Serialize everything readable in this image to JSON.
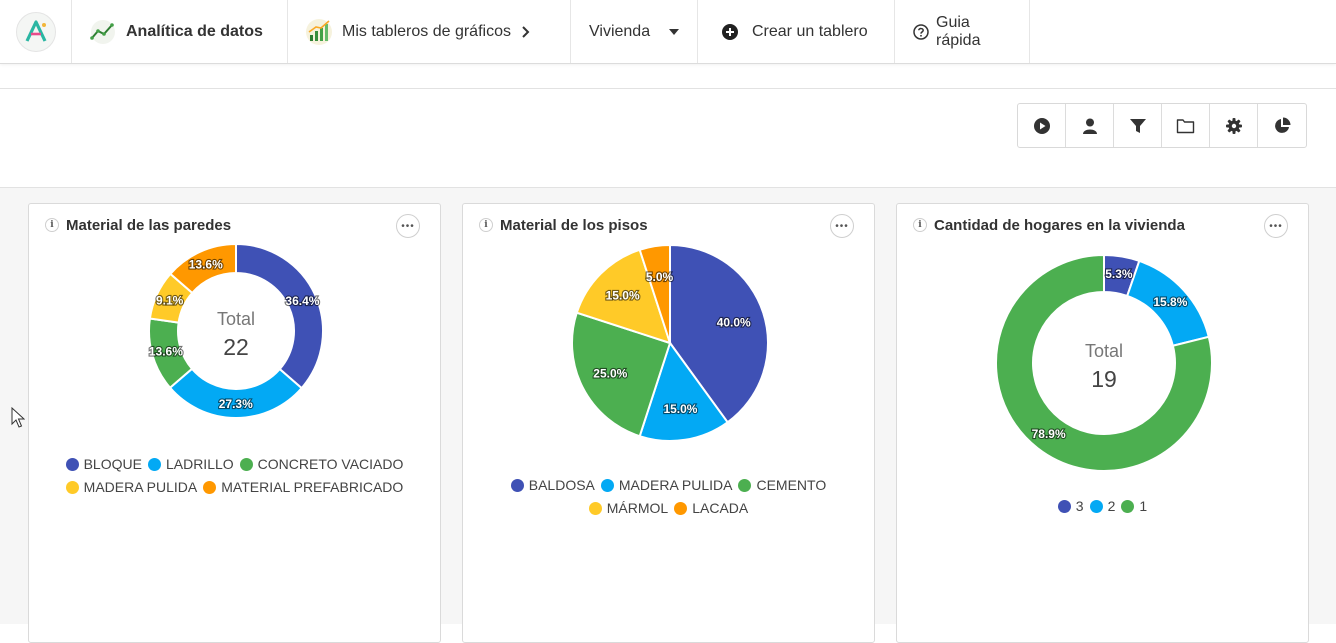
{
  "nav": {
    "analytics_label": "Analítica de datos",
    "boards_label": "Mis tableros de gráficos",
    "dataset_label": "Vivienda",
    "create_label": "Crear un tablero",
    "guide_label": "Guia rápida"
  },
  "toolbar": {
    "buttons": [
      "play-icon",
      "user-icon",
      "filter-icon",
      "folder-icon",
      "gear-icon",
      "pie-chart-icon"
    ]
  },
  "colors": {
    "blue": "#3F51B5",
    "lightblue": "#03A9F4",
    "green": "#4CAF50",
    "yellow": "#FFCA28",
    "orange": "#FF9800"
  },
  "cards": [
    {
      "title": "Material de las paredes",
      "total_label": "Total",
      "total_value": "22"
    },
    {
      "title": "Material de los pisos"
    },
    {
      "title": "Cantidad de hogares en la vivienda",
      "total_label": "Total",
      "total_value": "19"
    }
  ],
  "chart_data": [
    {
      "type": "pie",
      "subtype": "donut",
      "title": "Material de las paredes",
      "categories": [
        "BLOQUE",
        "LADRILLO",
        "CONCRETO VACIADO",
        "MADERA PULIDA",
        "MATERIAL PREFABRICADO"
      ],
      "values": [
        36.4,
        27.3,
        13.6,
        9.1,
        13.6
      ],
      "labels": [
        "36.4%",
        "27.3%",
        "13.6%",
        "9.1%",
        "13.6%"
      ],
      "colors": [
        "#3F51B5",
        "#03A9F4",
        "#4CAF50",
        "#FFCA28",
        "#FF9800"
      ],
      "center_text": [
        "Total",
        "22"
      ],
      "legend": "bottom"
    },
    {
      "type": "pie",
      "title": "Material de los pisos",
      "categories": [
        "BALDOSA",
        "MADERA PULIDA",
        "CEMENTO",
        "MÁRMOL",
        "LACADA"
      ],
      "values": [
        40.0,
        15.0,
        25.0,
        15.0,
        5.0
      ],
      "labels": [
        "40.0%",
        "15.0%",
        "25.0%",
        "15.0%",
        "5.0%"
      ],
      "colors": [
        "#3F51B5",
        "#03A9F4",
        "#4CAF50",
        "#FFCA28",
        "#FF9800"
      ],
      "legend": "bottom"
    },
    {
      "type": "pie",
      "subtype": "donut",
      "title": "Cantidad de hogares en la vivienda",
      "categories": [
        "3",
        "2",
        "1"
      ],
      "values": [
        5.3,
        15.8,
        78.9
      ],
      "labels": [
        "5.3%",
        "15.8%",
        "78.9%"
      ],
      "colors": [
        "#3F51B5",
        "#03A9F4",
        "#4CAF50"
      ],
      "center_text": [
        "Total",
        "19"
      ],
      "legend": "bottom"
    }
  ]
}
